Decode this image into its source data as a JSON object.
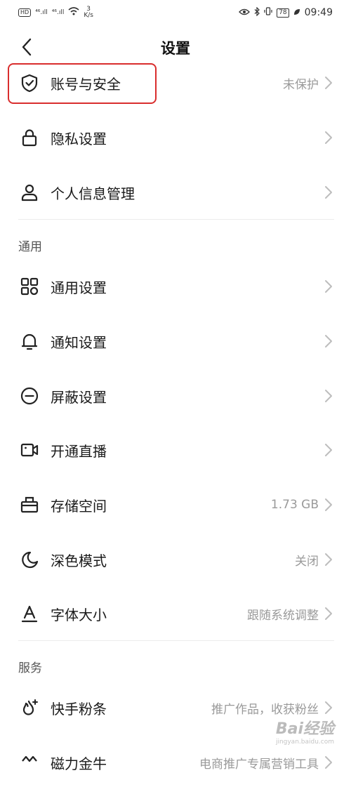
{
  "status_bar": {
    "hd": "HD",
    "signal_1": "⁴⁶.ıll",
    "signal_2": "⁴⁶.ıll",
    "speed_value": "3",
    "speed_unit": "K/s",
    "battery": "78",
    "time": "09:49"
  },
  "header": {
    "title": "设置"
  },
  "account_items": [
    {
      "label": "账号与安全",
      "value": "未保护"
    },
    {
      "label": "隐私设置",
      "value": ""
    },
    {
      "label": "个人信息管理",
      "value": ""
    }
  ],
  "general": {
    "section_title": "通用",
    "items": [
      {
        "label": "通用设置",
        "value": ""
      },
      {
        "label": "通知设置",
        "value": ""
      },
      {
        "label": "屏蔽设置",
        "value": ""
      },
      {
        "label": "开通直播",
        "value": ""
      },
      {
        "label": "存储空间",
        "value": "1.73 GB"
      },
      {
        "label": "深色模式",
        "value": "关闭"
      },
      {
        "label": "字体大小",
        "value": "跟随系统调整"
      }
    ]
  },
  "services": {
    "section_title": "服务",
    "items": [
      {
        "label": "快手粉条",
        "value": "推广作品，收获粉丝"
      },
      {
        "label": "磁力金牛",
        "value": "电商推广专属营销工具"
      }
    ]
  },
  "watermark": {
    "text": "Bai经验",
    "sub": "jingyan.baidu.com"
  },
  "colors": {
    "highlight": "#d92d2d",
    "value_text": "#9a9a9a"
  }
}
